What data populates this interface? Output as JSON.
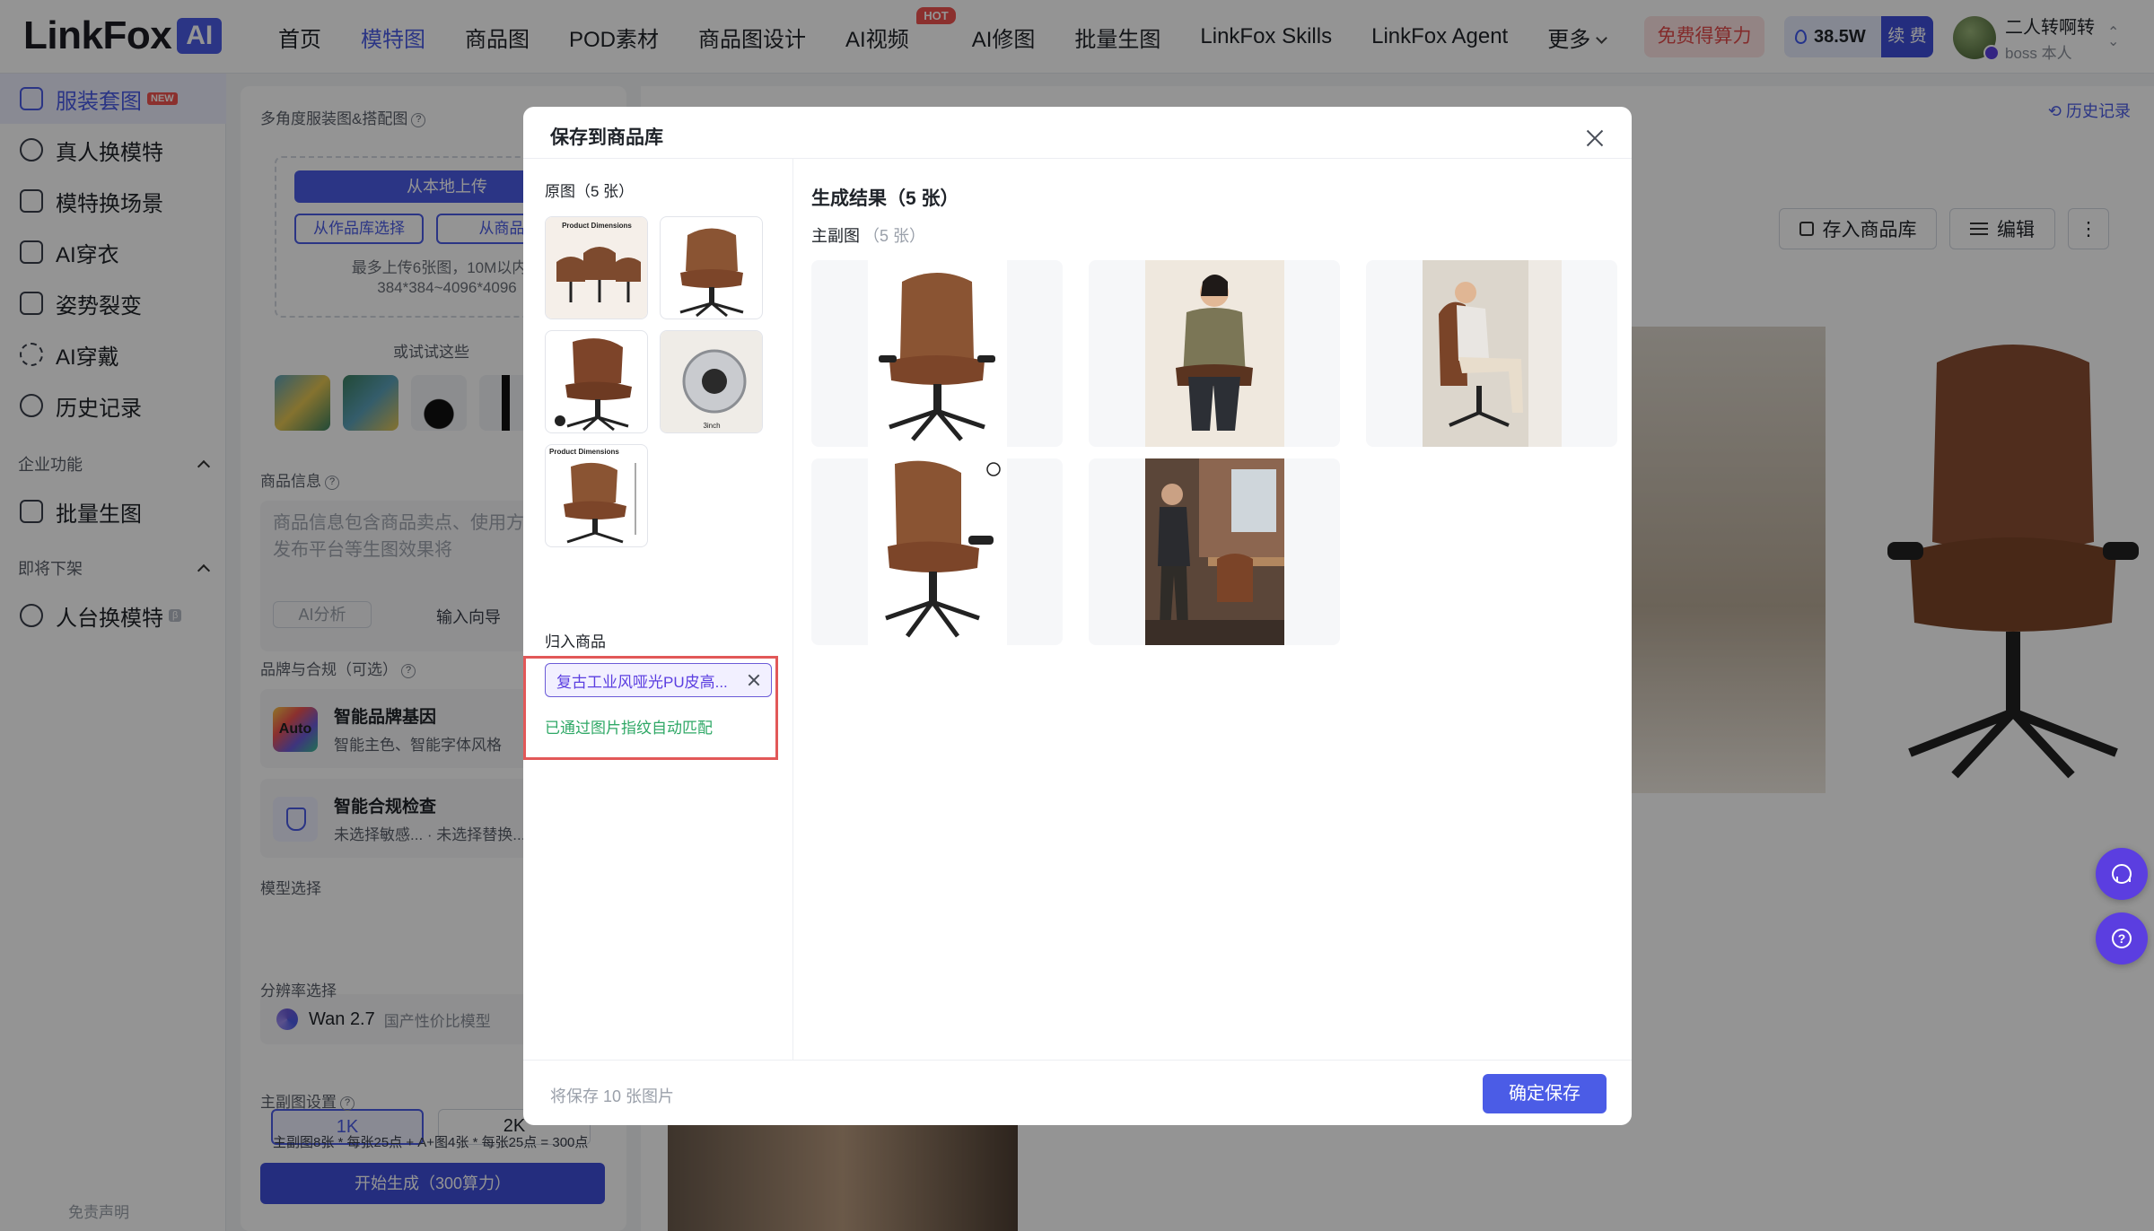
{
  "app": {
    "logo_text": "LinkFox",
    "logo_badge": "AI"
  },
  "nav": {
    "items": [
      {
        "label": "首页"
      },
      {
        "label": "模特图"
      },
      {
        "label": "商品图"
      },
      {
        "label": "POD素材"
      },
      {
        "label": "商品图设计"
      },
      {
        "label": "AI视频",
        "badge": "HOT"
      },
      {
        "label": "AI修图"
      },
      {
        "label": "批量生图"
      },
      {
        "label": "LinkFox Skills"
      },
      {
        "label": "LinkFox Agent"
      },
      {
        "label": "更多"
      }
    ],
    "active_index": 1,
    "free_credits": "免费得算力",
    "credits_value": "38.5W",
    "renew": "续 费",
    "user_name": "二人转啊转",
    "user_role": "boss 本人"
  },
  "sidebar": {
    "items": [
      {
        "label": "服装套图",
        "badge": "NEW"
      },
      {
        "label": "真人换模特"
      },
      {
        "label": "模特换场景"
      },
      {
        "label": "AI穿衣"
      },
      {
        "label": "姿势裂变"
      },
      {
        "label": "AI穿戴"
      },
      {
        "label": "历史记录"
      }
    ],
    "section_enterprise": "企业功能",
    "enterprise_items": [
      {
        "label": "批量生图"
      }
    ],
    "section_offline": "即将下架",
    "offline_items": [
      {
        "label": "人台换模特",
        "badge": "β"
      }
    ],
    "disclaimer": "免责声明"
  },
  "config": {
    "multi_angle_label": "多角度服装图&搭配图",
    "upload_local": "从本地上传",
    "from_works": "从作品库选择",
    "from_product": "从商品库选",
    "upload_hint": "最多上传6张图，10M以内，384*384~4096*4096",
    "try_these": "或试试这些",
    "product_info_label": "商品信息",
    "product_info_placeholder": "商品信息包含商品卖点、使用方 售地区、发布平台等生图效果将",
    "ai_analysis": "AI分析",
    "input_guide": "输入向导",
    "brand_label": "品牌与合规（可选）",
    "brand_gene_title": "智能品牌基因",
    "brand_gene_sub": "智能主色、智能字体风格",
    "brand_gene_chip": "Auto",
    "compliance_title": "智能合规检查",
    "compliance_sub": "未选择敏感... · 未选择替换...",
    "model_label": "模型选择",
    "model_name": "Wan 2.7",
    "model_tag": "国产性价比模型",
    "resolution_label": "分辨率选择",
    "res_1k": "1K",
    "res_2k": "2K",
    "main_setting_label": "主副图设置",
    "cost_line": "主副图8张 * 每张25点 + A+图4张 * 每张25点 = 300点",
    "generate_button": "开始生成（300算力）"
  },
  "result": {
    "history_link": "历史记录",
    "save_to_store": "存入商品库",
    "edit": "编辑"
  },
  "modal": {
    "title": "保存到商品库",
    "source_label": "原图（5 张）",
    "assign_label": "归入商品",
    "assigned_product": "复古工业风哑光PU皮高...",
    "match_note": "已通过图片指纹自动匹配",
    "results_label": "生成结果（5 张）",
    "main_sub_label": "主副图",
    "main_sub_count": "（5 张）",
    "footer_note": "将保存 10 张图片",
    "confirm_button": "确定保存",
    "source_thumb_texts": [
      "Product Dimensions",
      "3inch",
      "Product Dimensions"
    ]
  },
  "colors": {
    "accent": "#4b5ce6",
    "purple": "#5b3ee0",
    "success_text": "#2fa866",
    "highlight_border": "#e25858"
  }
}
